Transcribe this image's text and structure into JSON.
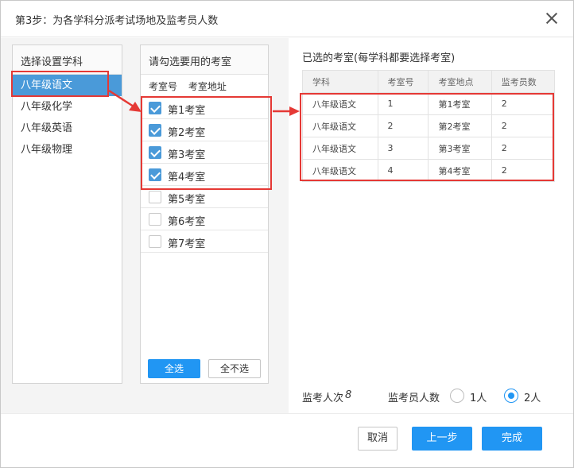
{
  "dialog": {
    "title": "第3步：为各学科分派考试场地及监考员人数"
  },
  "subjects": {
    "header": "选择设置学科",
    "items": [
      {
        "label": "八年级语文",
        "active": true
      },
      {
        "label": "八年级化学",
        "active": false
      },
      {
        "label": "八年级英语",
        "active": false
      },
      {
        "label": "八年级物理",
        "active": false
      }
    ]
  },
  "rooms": {
    "header": "请勾选要用的考室",
    "col_number": "考室号",
    "col_address": "考室地址",
    "items": [
      {
        "label": "第1考室",
        "checked": true
      },
      {
        "label": "第2考室",
        "checked": true
      },
      {
        "label": "第3考室",
        "checked": true
      },
      {
        "label": "第4考室",
        "checked": true
      },
      {
        "label": "第5考室",
        "checked": false
      },
      {
        "label": "第6考室",
        "checked": false
      },
      {
        "label": "第7考室",
        "checked": false
      }
    ],
    "select_all": "全选",
    "select_none": "全不选"
  },
  "selected": {
    "title": "已选的考室(每学科都要选择考室)",
    "columns": [
      "学科",
      "考室号",
      "考室地点",
      "监考员数"
    ],
    "rows": [
      [
        "八年级语文",
        "1",
        "第1考室",
        "2"
      ],
      [
        "八年级语文",
        "2",
        "第2考室",
        "2"
      ],
      [
        "八年级语文",
        "3",
        "第3考室",
        "2"
      ],
      [
        "八年级语文",
        "4",
        "第4考室",
        "2"
      ]
    ]
  },
  "stats": {
    "proctor_times_label": "监考人次",
    "proctor_times_value": "8",
    "proctor_count_label": "监考员人数",
    "option_1": "1人",
    "option_2": "2人",
    "selected_option": "2人"
  },
  "footer": {
    "cancel": "取消",
    "prev": "上一步",
    "done": "完成"
  },
  "colors": {
    "accent": "#2196f3",
    "active_item": "#4a9ad9",
    "annotation": "#e53935"
  }
}
